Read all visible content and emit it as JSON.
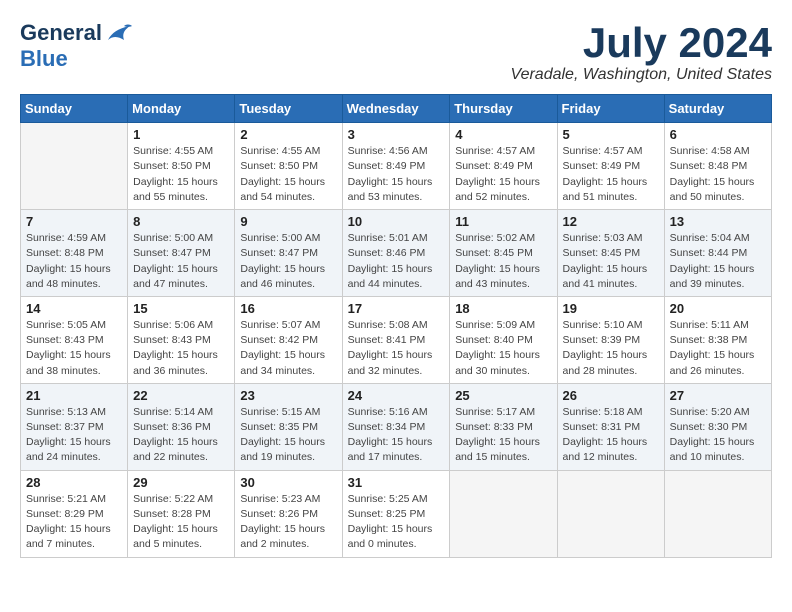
{
  "logo": {
    "line1": "General",
    "line2": "Blue"
  },
  "title": "July 2024",
  "location": "Veradale, Washington, United States",
  "weekdays": [
    "Sunday",
    "Monday",
    "Tuesday",
    "Wednesday",
    "Thursday",
    "Friday",
    "Saturday"
  ],
  "weeks": [
    [
      {
        "day": "",
        "info": ""
      },
      {
        "day": "1",
        "info": "Sunrise: 4:55 AM\nSunset: 8:50 PM\nDaylight: 15 hours\nand 55 minutes."
      },
      {
        "day": "2",
        "info": "Sunrise: 4:55 AM\nSunset: 8:50 PM\nDaylight: 15 hours\nand 54 minutes."
      },
      {
        "day": "3",
        "info": "Sunrise: 4:56 AM\nSunset: 8:49 PM\nDaylight: 15 hours\nand 53 minutes."
      },
      {
        "day": "4",
        "info": "Sunrise: 4:57 AM\nSunset: 8:49 PM\nDaylight: 15 hours\nand 52 minutes."
      },
      {
        "day": "5",
        "info": "Sunrise: 4:57 AM\nSunset: 8:49 PM\nDaylight: 15 hours\nand 51 minutes."
      },
      {
        "day": "6",
        "info": "Sunrise: 4:58 AM\nSunset: 8:48 PM\nDaylight: 15 hours\nand 50 minutes."
      }
    ],
    [
      {
        "day": "7",
        "info": "Sunrise: 4:59 AM\nSunset: 8:48 PM\nDaylight: 15 hours\nand 48 minutes."
      },
      {
        "day": "8",
        "info": "Sunrise: 5:00 AM\nSunset: 8:47 PM\nDaylight: 15 hours\nand 47 minutes."
      },
      {
        "day": "9",
        "info": "Sunrise: 5:00 AM\nSunset: 8:47 PM\nDaylight: 15 hours\nand 46 minutes."
      },
      {
        "day": "10",
        "info": "Sunrise: 5:01 AM\nSunset: 8:46 PM\nDaylight: 15 hours\nand 44 minutes."
      },
      {
        "day": "11",
        "info": "Sunrise: 5:02 AM\nSunset: 8:45 PM\nDaylight: 15 hours\nand 43 minutes."
      },
      {
        "day": "12",
        "info": "Sunrise: 5:03 AM\nSunset: 8:45 PM\nDaylight: 15 hours\nand 41 minutes."
      },
      {
        "day": "13",
        "info": "Sunrise: 5:04 AM\nSunset: 8:44 PM\nDaylight: 15 hours\nand 39 minutes."
      }
    ],
    [
      {
        "day": "14",
        "info": "Sunrise: 5:05 AM\nSunset: 8:43 PM\nDaylight: 15 hours\nand 38 minutes."
      },
      {
        "day": "15",
        "info": "Sunrise: 5:06 AM\nSunset: 8:43 PM\nDaylight: 15 hours\nand 36 minutes."
      },
      {
        "day": "16",
        "info": "Sunrise: 5:07 AM\nSunset: 8:42 PM\nDaylight: 15 hours\nand 34 minutes."
      },
      {
        "day": "17",
        "info": "Sunrise: 5:08 AM\nSunset: 8:41 PM\nDaylight: 15 hours\nand 32 minutes."
      },
      {
        "day": "18",
        "info": "Sunrise: 5:09 AM\nSunset: 8:40 PM\nDaylight: 15 hours\nand 30 minutes."
      },
      {
        "day": "19",
        "info": "Sunrise: 5:10 AM\nSunset: 8:39 PM\nDaylight: 15 hours\nand 28 minutes."
      },
      {
        "day": "20",
        "info": "Sunrise: 5:11 AM\nSunset: 8:38 PM\nDaylight: 15 hours\nand 26 minutes."
      }
    ],
    [
      {
        "day": "21",
        "info": "Sunrise: 5:13 AM\nSunset: 8:37 PM\nDaylight: 15 hours\nand 24 minutes."
      },
      {
        "day": "22",
        "info": "Sunrise: 5:14 AM\nSunset: 8:36 PM\nDaylight: 15 hours\nand 22 minutes."
      },
      {
        "day": "23",
        "info": "Sunrise: 5:15 AM\nSunset: 8:35 PM\nDaylight: 15 hours\nand 19 minutes."
      },
      {
        "day": "24",
        "info": "Sunrise: 5:16 AM\nSunset: 8:34 PM\nDaylight: 15 hours\nand 17 minutes."
      },
      {
        "day": "25",
        "info": "Sunrise: 5:17 AM\nSunset: 8:33 PM\nDaylight: 15 hours\nand 15 minutes."
      },
      {
        "day": "26",
        "info": "Sunrise: 5:18 AM\nSunset: 8:31 PM\nDaylight: 15 hours\nand 12 minutes."
      },
      {
        "day": "27",
        "info": "Sunrise: 5:20 AM\nSunset: 8:30 PM\nDaylight: 15 hours\nand 10 minutes."
      }
    ],
    [
      {
        "day": "28",
        "info": "Sunrise: 5:21 AM\nSunset: 8:29 PM\nDaylight: 15 hours\nand 7 minutes."
      },
      {
        "day": "29",
        "info": "Sunrise: 5:22 AM\nSunset: 8:28 PM\nDaylight: 15 hours\nand 5 minutes."
      },
      {
        "day": "30",
        "info": "Sunrise: 5:23 AM\nSunset: 8:26 PM\nDaylight: 15 hours\nand 2 minutes."
      },
      {
        "day": "31",
        "info": "Sunrise: 5:25 AM\nSunset: 8:25 PM\nDaylight: 15 hours\nand 0 minutes."
      },
      {
        "day": "",
        "info": ""
      },
      {
        "day": "",
        "info": ""
      },
      {
        "day": "",
        "info": ""
      }
    ]
  ]
}
